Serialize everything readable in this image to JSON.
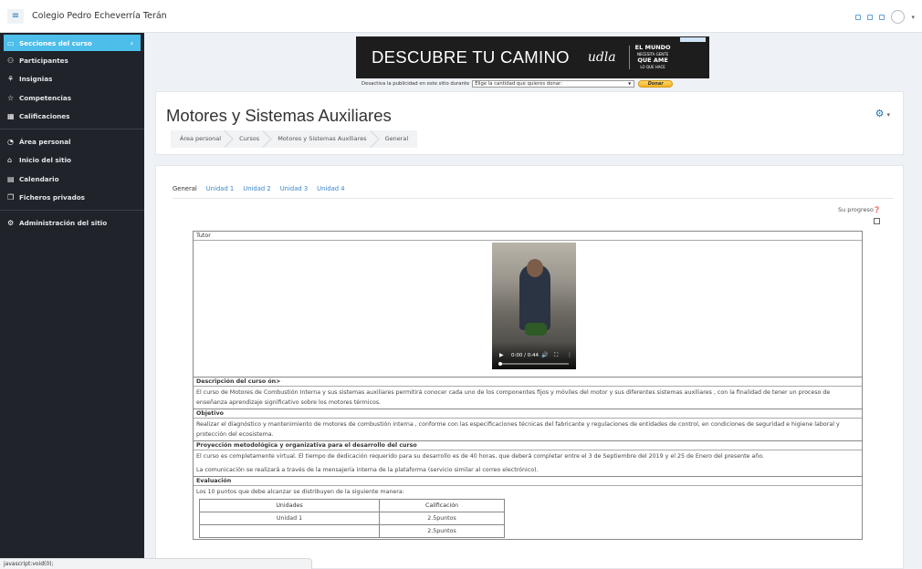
{
  "topbar": {
    "site_name": "Colegio Pedro Echeverría Terán",
    "menu_icon": "hamburger-icon"
  },
  "sidebar": {
    "items": [
      {
        "label": "Secciones del curso",
        "icon": "folder-icon",
        "active": true
      },
      {
        "label": "Participantes",
        "icon": "users-icon"
      },
      {
        "label": "Insignias",
        "icon": "badge-icon"
      },
      {
        "label": "Competencias",
        "icon": "star-icon"
      },
      {
        "label": "Calificaciones",
        "icon": "grades-icon"
      }
    ],
    "items2": [
      {
        "label": "Área personal",
        "icon": "dashboard-icon"
      },
      {
        "label": "Inicio del sitio",
        "icon": "home-icon"
      },
      {
        "label": "Calendario",
        "icon": "calendar-icon"
      },
      {
        "label": "Ficheros privados",
        "icon": "files-icon"
      }
    ],
    "items3": [
      {
        "label": "Administración del sitio",
        "icon": "settings-icon"
      }
    ]
  },
  "ad": {
    "headline": "DESCUBRE TU CAMINO",
    "signature": "udla",
    "brand_line1": "EL MUNDO",
    "brand_line2": "NECESITA GENTE",
    "brand_line3": "QUE AME",
    "brand_line4": "LO QUE HACE",
    "donate_text": "Desactiva la publicidad en este sitio durante",
    "donate_select": "Elige la cantidad que quieres donar:",
    "donate_button": "Donar"
  },
  "header": {
    "course_title": "Motores y Sistemas Auxiliares",
    "breadcrumb": [
      "Área personal",
      "Cursos",
      "Motores y Sistemas Auxiliares",
      "General"
    ]
  },
  "tabs": [
    {
      "label": "General",
      "active": true
    },
    {
      "label": "Unidad 1"
    },
    {
      "label": "Unidad 2"
    },
    {
      "label": "Unidad 3"
    },
    {
      "label": "Unidad 4"
    }
  ],
  "progress_label": "Su progreso",
  "content": {
    "tutor_header": "Tutor",
    "video_time": "0:00 / 0:44",
    "video_progress": 0.0,
    "desc_header": "Descripción del curso ón>",
    "desc_text": "El curso de Motores de Combustión Interna y sus sistemas auxiliares permitirá conocer cada uno de los componentes fijos y móviles del motor y sus diferentes sistemas auxiliares , con la finalidad de tener un proceso de enseñanza aprendizaje significativo sobre los motores térmicos.",
    "obj_header": "Objetivo",
    "obj_text": "Realizar el diagnóstico y mantenimiento de motores de combustión interna , conforme con las especificaciones técnicas del fabricante y regulaciones de entidades de control, en condiciones de seguridad e higiene laboral y protección del ecosistema.",
    "proj_header": "Proyección metodológica y organizativa para el desarrollo del curso",
    "proj_text1": "El curso es completamente virtual. El tiempo de dedicación requerido para su desarrollo es de 40 horas, que deberá completar entre el 3 de Septiembre del 2019 y el 25 de Enero del presente año.",
    "proj_text2": "La comunicación se realizará a través de la mensajería interna de la plataforma (servicio similar al correo electrónico).",
    "eval_header": "Evaluación",
    "eval_text": "Los 10 puntos que debe alcanzar se distribuyen de la siguiente manera:",
    "eval_table": {
      "headers": [
        "Unidades",
        "Calificación"
      ],
      "rows": [
        [
          "Unidad 1",
          "2.5puntos"
        ],
        [
          "",
          "2.5puntos"
        ]
      ]
    }
  },
  "statusbar": "javascript:void(0);"
}
